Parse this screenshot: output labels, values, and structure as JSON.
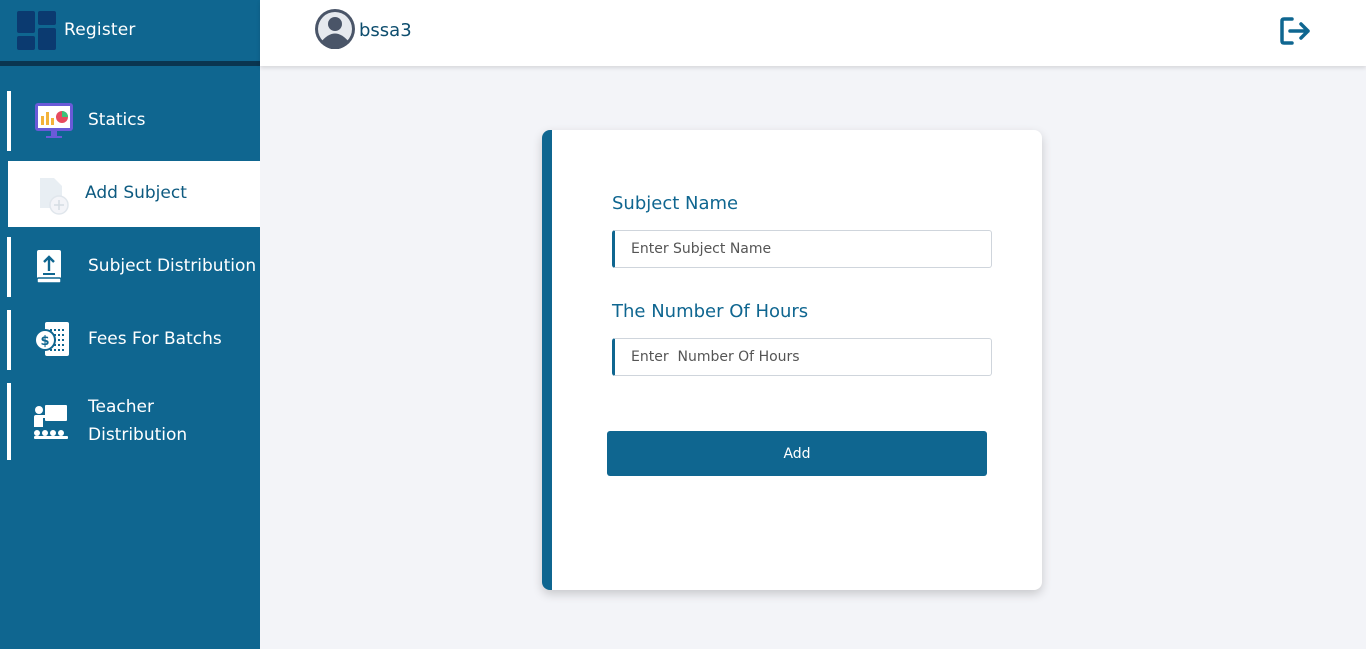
{
  "brand": {
    "title": "Register"
  },
  "user": {
    "name": "bssa3"
  },
  "sidebar": {
    "items": [
      {
        "label": "Statics",
        "icon": "statistics-icon"
      },
      {
        "label": "Add Subject",
        "icon": "add-document-icon",
        "active": true
      },
      {
        "label": "Subject Distribution",
        "icon": "book-upload-icon"
      },
      {
        "label": "Fees For Batchs",
        "icon": "fees-invoice-icon"
      },
      {
        "label": "Teacher Distribution",
        "label_lines": [
          "Teacher",
          "Distribution"
        ],
        "icon": "teacher-board-icon"
      }
    ]
  },
  "form": {
    "subject_name_label": "Subject Name",
    "subject_name_placeholder": "Enter Subject Name",
    "hours_label": "The Number Of Hours",
    "hours_placeholder": "Enter  Number Of Hours",
    "submit_label": "Add"
  },
  "colors": {
    "primary": "#0f6690",
    "sidebar_bg": "#0f6690",
    "page_bg": "#f3f4f8",
    "card_bg": "#ffffff"
  }
}
